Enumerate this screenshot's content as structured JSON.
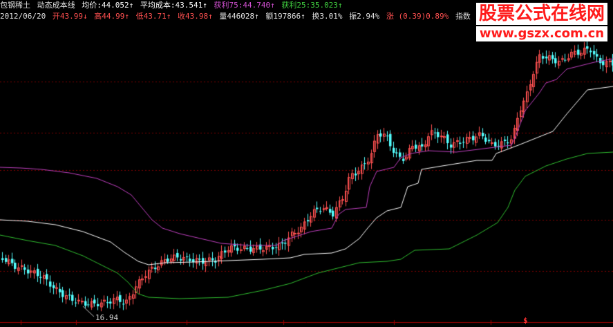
{
  "header": {
    "stock_name": "包钢稀土",
    "indicator_name": "动态成本线",
    "avg_price": "均价:44.052↑",
    "avg_cost": "平均成本:43.541↑",
    "profit75": "获利75:44.740↑",
    "profit25": "获利25:35.023↑"
  },
  "quote": {
    "date": "2012/06/20",
    "open": "开43.99↓",
    "high": "高44.99↑",
    "low": "低43.71↑",
    "close": "收43.98↑",
    "volume": "量446028↑",
    "amount": "额197866↑",
    "turnover": "换3.01%",
    "amplitude": "振2.94%",
    "change": "涨 (0.39)0.89%",
    "index": "指数 (-7.92)-0."
  },
  "watermark": {
    "title": "股票公式在线网",
    "url": "www.gszx.com.cn"
  },
  "low_label": "16.94",
  "bottom_marker": "$",
  "colors": {
    "background": "#000000",
    "up_candle": "#ff5050",
    "down_candle": "#54ffff",
    "avg_cost_line": "#ffffff",
    "profit75_line": "#c040c0",
    "profit25_line": "#30c030",
    "grid": "#800000"
  }
}
